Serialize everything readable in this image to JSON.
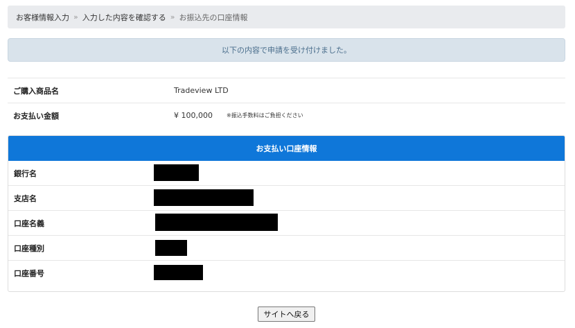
{
  "breadcrumb": {
    "items": [
      "お客様情報入力",
      "入力した内容を確認する",
      "お振込先の口座情報"
    ],
    "separator": "»"
  },
  "alert": {
    "message": "以下の内容で申請を受け付けました。"
  },
  "order": {
    "product_label": "ご購入商品名",
    "product_value": "Tradeview LTD",
    "amount_label": "お支払い金額",
    "amount_value": "¥ 100,000",
    "amount_note": "※振込手数料はご負担ください"
  },
  "bank_panel": {
    "title": "お支払い口座情報",
    "header_color": "#0f77d9",
    "rows": [
      {
        "label": "銀行名"
      },
      {
        "label": "支店名"
      },
      {
        "label": "口座名義"
      },
      {
        "label": "口座種別"
      },
      {
        "label": "口座番号"
      }
    ]
  },
  "back_button": {
    "label": "サイトへ戻る"
  }
}
